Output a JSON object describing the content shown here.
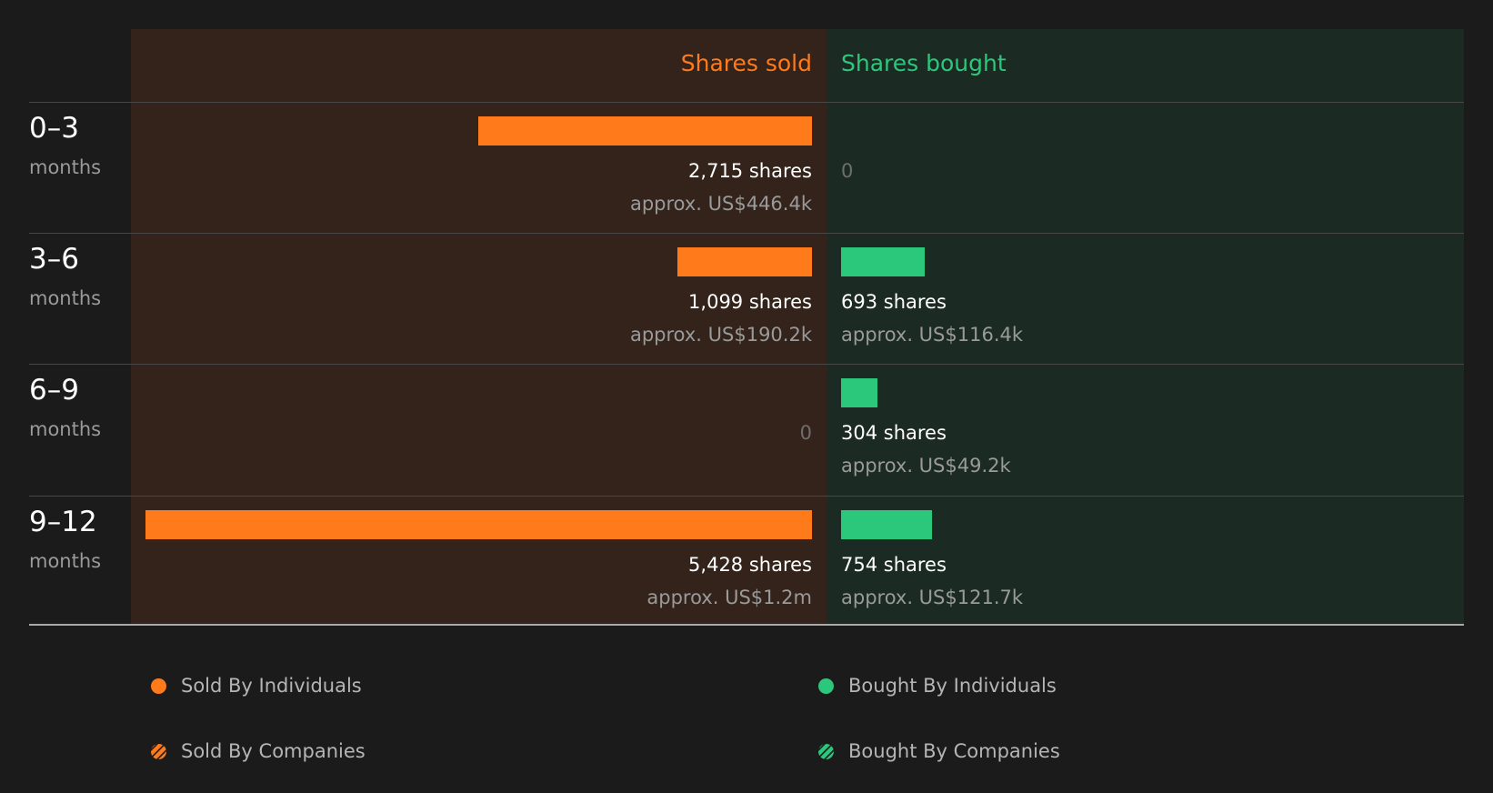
{
  "chart_data": {
    "type": "bar",
    "orientation": "horizontal-diverging",
    "headers": {
      "sold": "Shares sold",
      "bought": "Shares bought"
    },
    "unit_label": "months",
    "categories": [
      "0–3",
      "3–6",
      "6–9",
      "9–12"
    ],
    "series": [
      {
        "name": "Shares sold",
        "values": [
          2715,
          1099,
          0,
          5428
        ],
        "shares_text": [
          "2,715 shares",
          "1,099 shares",
          "0",
          "5,428 shares"
        ],
        "approx_text": [
          "approx. US$446.4k",
          "approx. US$190.2k",
          "",
          "approx. US$1.2m"
        ]
      },
      {
        "name": "Shares bought",
        "values": [
          0,
          693,
          304,
          754
        ],
        "shares_text": [
          "0",
          "693 shares",
          "304 shares",
          "754 shares"
        ],
        "approx_text": [
          "",
          "approx. US$116.4k",
          "approx. US$49.2k",
          "approx. US$121.7k"
        ]
      }
    ],
    "legend": [
      {
        "label": "Sold By Individuals",
        "icon": "solid-dot"
      },
      {
        "label": "Bought By Individuals",
        "icon": "solid-dot"
      },
      {
        "label": "Sold By Companies",
        "icon": "hatched-dot"
      },
      {
        "label": "Bought By Companies",
        "icon": "hatched-dot"
      }
    ],
    "colors": {
      "sold": "#ff7a1a",
      "bought": "#2bc77b",
      "sold_bg": "#33231b",
      "bought_bg": "#1b2b24"
    },
    "grid": false,
    "legend_position": "bottom"
  }
}
